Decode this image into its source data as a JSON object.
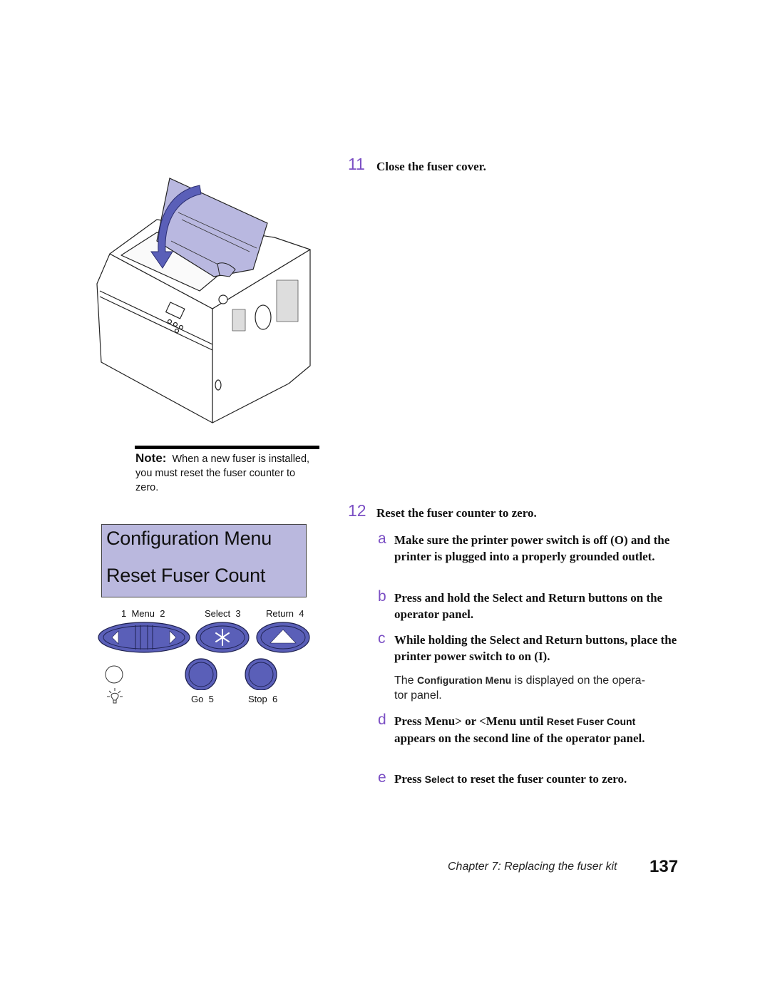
{
  "illustration": {
    "description": "Printer with fuser cover being closed",
    "arrow_color": "#5a5fb8",
    "cover_color": "#b9b8e0"
  },
  "note": {
    "label": "Note:",
    "text": "When a new fuser is installed, you must reset the fuser counter to zero."
  },
  "operator_panel": {
    "lcd_line1": "Configuration Menu",
    "lcd_line2": "Reset Fuser Count",
    "lcd_color": "#bab8de",
    "button_color": "#5a5fb8",
    "buttons": {
      "menu_label": "1  Menu  2",
      "select_label": "Select  3",
      "return_label": "Return  4",
      "go_label": "Go  5",
      "stop_label": "Stop  6"
    }
  },
  "steps": [
    {
      "number": "11",
      "text": "Close the fuser cover."
    },
    {
      "number": "12",
      "text": "Reset the fuser counter to zero.",
      "substeps": [
        {
          "letter": "a",
          "text": "Make sure the printer power switch is off (O) and the printer is plugged into a properly grounded outlet."
        },
        {
          "letter": "b",
          "text": "Press and hold the Select and Return buttons on the operator panel."
        },
        {
          "letter": "c",
          "text": "While holding the Select and Return buttons, place the printer power switch to on (I).",
          "result_pre": "The ",
          "result_term": "Configuration Menu",
          "result_post": " is displayed on the opera-",
          "result_line2": "tor panel."
        },
        {
          "letter": "d",
          "text_pre": "Press Menu> or <Menu until ",
          "term": "Reset Fuser Count",
          "text_post": " appears on the second line of the operator panel."
        },
        {
          "letter": "e",
          "text_pre": "Press ",
          "term": "Select",
          "text_post": " to reset the fuser counter to zero."
        }
      ]
    }
  ],
  "footer": {
    "chapter": "Chapter 7: Replacing the fuser kit",
    "page": "137"
  },
  "colors": {
    "accent": "#7b4fc4"
  }
}
